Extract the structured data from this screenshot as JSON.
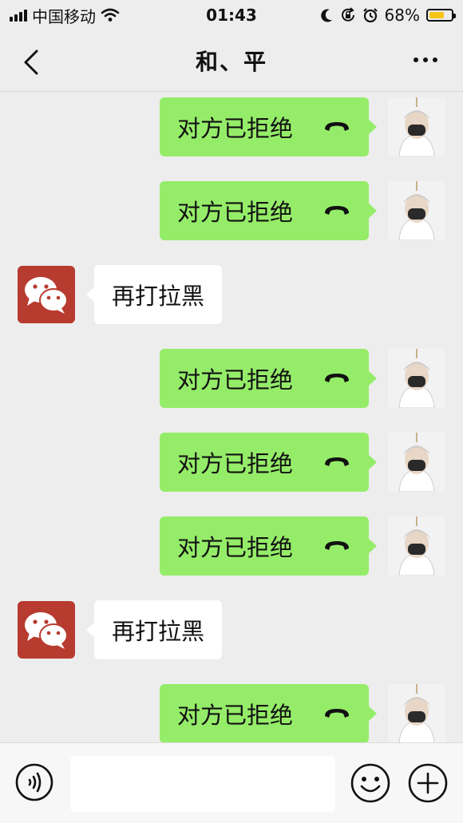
{
  "status_bar": {
    "carrier": "中国移动",
    "time": "01:43",
    "battery_percent": "68%",
    "battery_level": 0.68,
    "icons": [
      "signal-icon",
      "wifi-icon",
      "moon-icon",
      "rotation-lock-icon",
      "alarm-icon",
      "battery-icon"
    ]
  },
  "nav": {
    "title": "和、平",
    "back_icon": "chevron-left-icon",
    "more_icon": "more-dots-icon"
  },
  "messages": [
    {
      "side": "right",
      "text": "对方已拒绝",
      "icon": "hang-up-phone-icon"
    },
    {
      "side": "right",
      "text": "对方已拒绝",
      "icon": "hang-up-phone-icon"
    },
    {
      "side": "left",
      "text": "再打拉黑"
    },
    {
      "side": "right",
      "text": "对方已拒绝",
      "icon": "hang-up-phone-icon"
    },
    {
      "side": "right",
      "text": "对方已拒绝",
      "icon": "hang-up-phone-icon"
    },
    {
      "side": "right",
      "text": "对方已拒绝",
      "icon": "hang-up-phone-icon"
    },
    {
      "side": "left",
      "text": "再打拉黑"
    },
    {
      "side": "right",
      "text": "对方已拒绝",
      "icon": "hang-up-phone-icon"
    }
  ],
  "input_bar": {
    "voice_icon": "voice-icon",
    "emoji_icon": "emoji-icon",
    "plus_icon": "plus-icon",
    "input_value": ""
  },
  "colors": {
    "background": "#ededed",
    "bubble_sent": "#95ec69",
    "bubble_received": "#ffffff",
    "wechat_avatar": "#b83b30",
    "battery": "#f5c518"
  }
}
